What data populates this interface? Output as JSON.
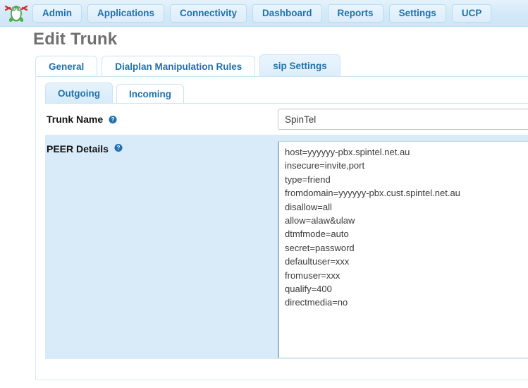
{
  "navbar": {
    "brand_icon": "freepbx-frog-logo",
    "items": [
      {
        "label": "Admin",
        "name": "admin"
      },
      {
        "label": "Applications",
        "name": "applications"
      },
      {
        "label": "Connectivity",
        "name": "connectivity"
      },
      {
        "label": "Dashboard",
        "name": "dashboard"
      },
      {
        "label": "Reports",
        "name": "reports"
      },
      {
        "label": "Settings",
        "name": "settings"
      },
      {
        "label": "UCP",
        "name": "ucp"
      }
    ]
  },
  "page": {
    "title": "Edit Trunk"
  },
  "outer_tabs": [
    {
      "label": "General",
      "active": false
    },
    {
      "label": "Dialplan Manipulation Rules",
      "active": false
    },
    {
      "label": "sip Settings",
      "active": true
    }
  ],
  "inner_tabs": [
    {
      "label": "Outgoing",
      "active": true
    },
    {
      "label": "Incoming",
      "active": false
    }
  ],
  "form": {
    "trunk_name": {
      "label": "Trunk Name",
      "help_icon": "question-circle-icon",
      "value": "SpinTel",
      "placeholder": ""
    },
    "peer_details": {
      "label": "PEER Details",
      "help_icon": "question-circle-icon",
      "placeholder": "",
      "value": "host=yyyyyy-pbx.spintel.net.au\ninsecure=invite,port\ntype=friend\nfromdomain=yyyyyy-pbx.cust.spintel.net.au\ndisallow=all\nallow=alaw&ulaw\ndtmfmode=auto\nsecret=password\ndefaultuser=xxx\nfromuser=xxx\nqualify=400\ndirectmedia=no"
    }
  },
  "colors": {
    "navbar_bg": "#d7eaf8",
    "nav_text": "#1f72ad",
    "title_text": "#6f6f6f",
    "striped_row_bg": "#d9ebf8",
    "tab_border": "#c9e4f5",
    "help_icon": "#1f72ad"
  }
}
